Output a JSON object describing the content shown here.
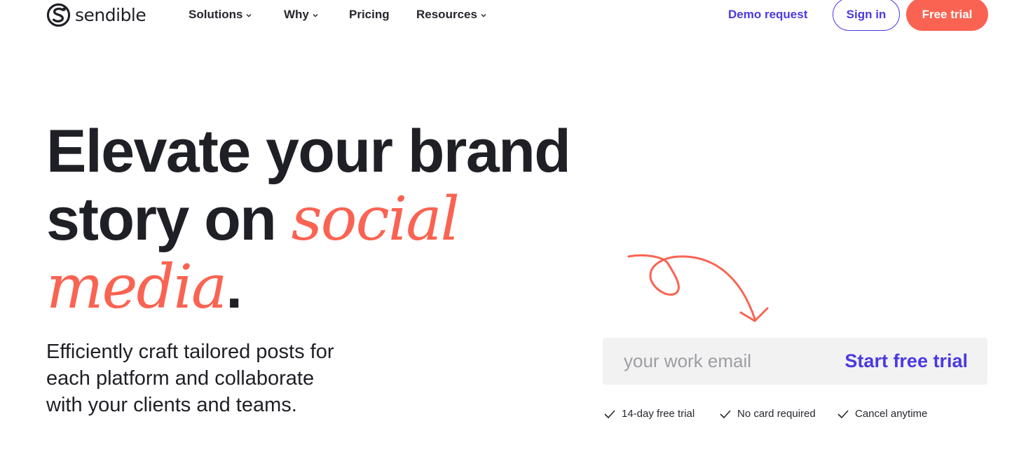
{
  "brand": {
    "name": "sendible",
    "logo_icon": "sendible-logo-icon"
  },
  "nav": {
    "items": [
      {
        "label": "Solutions",
        "has_dropdown": true
      },
      {
        "label": "Why",
        "has_dropdown": true
      },
      {
        "label": "Pricing",
        "has_dropdown": false
      },
      {
        "label": "Resources",
        "has_dropdown": true
      }
    ],
    "demo_label": "Demo request",
    "signin_label": "Sign in",
    "free_trial_label": "Free trial"
  },
  "hero": {
    "title_line1": "Elevate your brand",
    "title_line2_plain": "story on ",
    "title_line2_accent": "social",
    "title_line3_accent": "media",
    "title_line3_end": ".",
    "subtitle": "Efficiently craft tailored posts for each platform and collaborate with your clients and teams."
  },
  "signup": {
    "email_placeholder": "your work email",
    "email_value": "",
    "cta_label": "Start free trial",
    "benefits": [
      "14-day free trial",
      "No card required",
      "Cancel anytime"
    ]
  },
  "colors": {
    "accent_coral": "#fa6352",
    "accent_purple": "#4a3ae0",
    "text_dark": "#1f1f26",
    "input_bg": "#f2f2f3"
  }
}
